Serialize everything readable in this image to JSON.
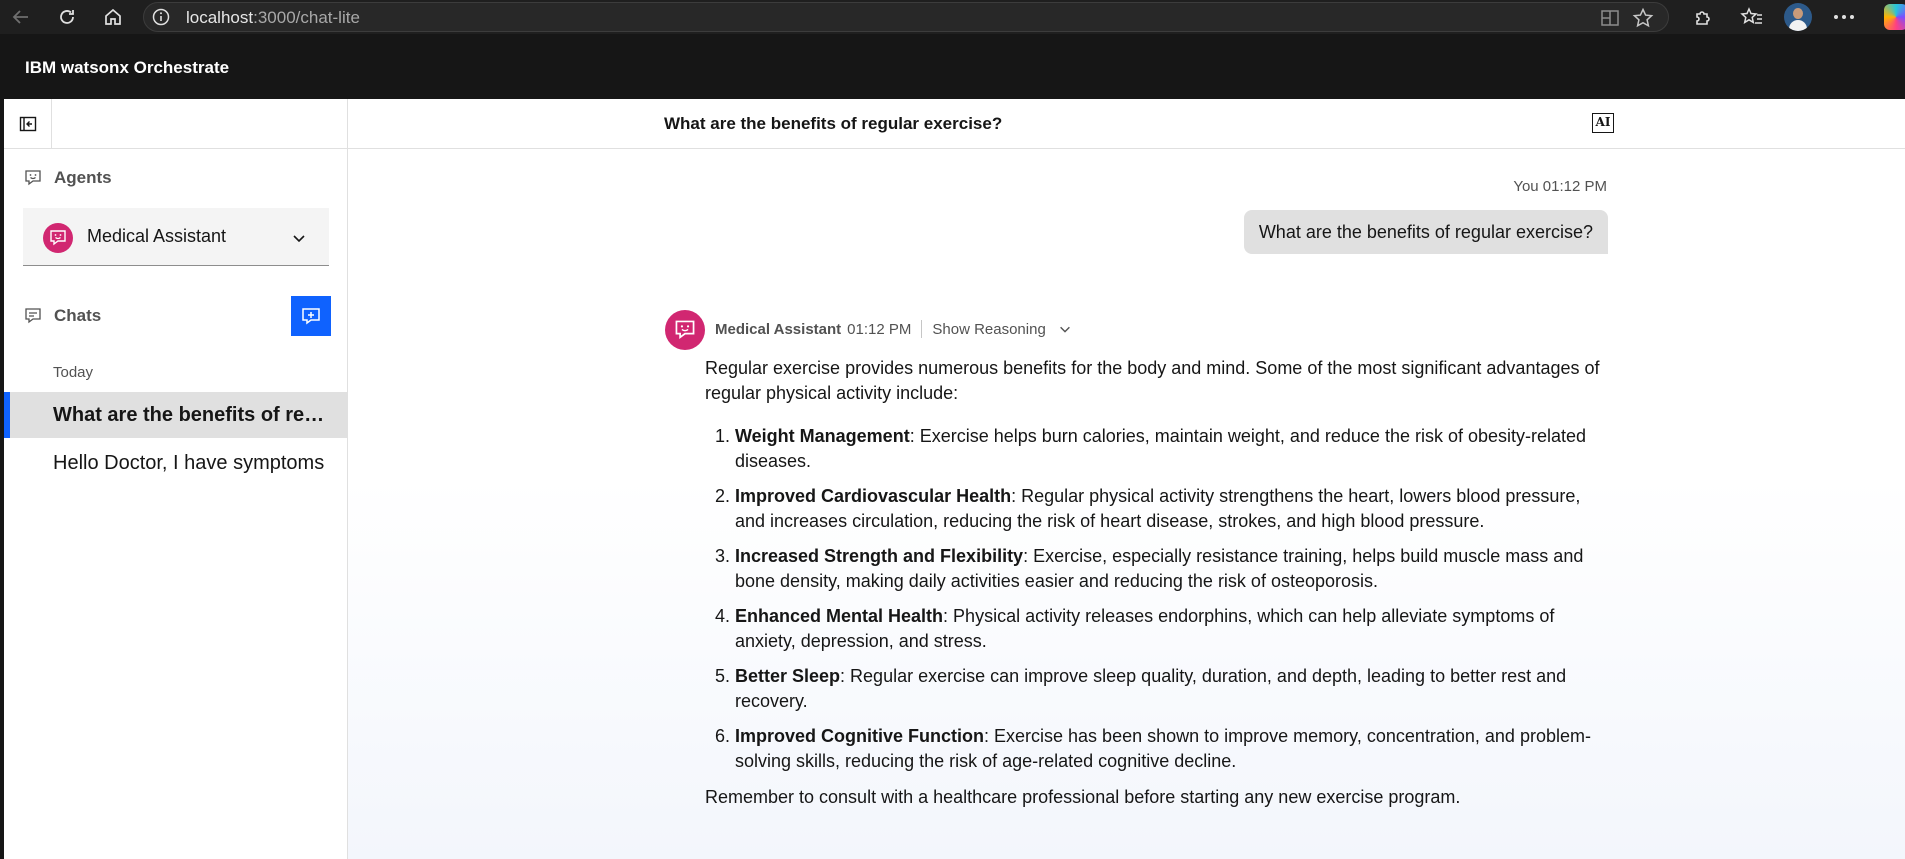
{
  "browser": {
    "url_host": "localhost",
    "url_path": ":3000/chat-lite"
  },
  "app": {
    "title": "IBM watsonx Orchestrate"
  },
  "sidebar": {
    "agents_heading": "Agents",
    "selected_agent": "Medical Assistant",
    "chats_heading": "Chats",
    "date_group": "Today",
    "chats": [
      {
        "label": "What are the benefits of regular exercise?",
        "active": true
      },
      {
        "label": "Hello Doctor, I have symptoms",
        "active": false
      }
    ]
  },
  "main": {
    "chat_title": "What are the benefits of regular exercise?",
    "ai_badge": "AI",
    "user_message": {
      "meta": "You 01:12 PM",
      "text": "What are the benefits of regular exercise?"
    },
    "bot_message": {
      "name": "Medical Assistant",
      "time": "01:12 PM",
      "reasoning_label": "Show Reasoning",
      "intro": "Regular exercise provides numerous benefits for the body and mind. Some of the most significant advantages of regular physical activity include:",
      "items": [
        {
          "title": "Weight Management",
          "text": ": Exercise helps burn calories, maintain weight, and reduce the risk of obesity-related diseases."
        },
        {
          "title": "Improved Cardiovascular Health",
          "text": ": Regular physical activity strengthens the heart, lowers blood pressure, and increases circulation, reducing the risk of heart disease, strokes, and high blood pressure."
        },
        {
          "title": "Increased Strength and Flexibility",
          "text": ": Exercise, especially resistance training, helps build muscle mass and bone density, making daily activities easier and reducing the risk of osteoporosis."
        },
        {
          "title": "Enhanced Mental Health",
          "text": ": Physical activity releases endorphins, which can help alleviate symptoms of anxiety, depression, and stress."
        },
        {
          "title": "Better Sleep",
          "text": ": Regular exercise can improve sleep quality, duration, and depth, leading to better rest and recovery."
        },
        {
          "title": "Improved Cognitive Function",
          "text": ": Exercise has been shown to improve memory, concentration, and problem-solving skills, reducing the risk of age-related cognitive decline."
        }
      ],
      "closing": "Remember to consult with a healthcare professional before starting any new exercise program."
    }
  },
  "colors": {
    "accent": "#0f62fe",
    "agent_avatar": "#d12771",
    "header_bg": "#161616"
  },
  "icons": [
    "back-arrow-icon",
    "reload-icon",
    "home-icon",
    "info-icon",
    "split-screen-icon",
    "favorite-star-icon",
    "extensions-icon",
    "favorites-icon",
    "more-icon",
    "collapse-sidebar-icon",
    "agent-icon",
    "chat-icon",
    "new-chat-icon",
    "chevron-down-icon"
  ]
}
